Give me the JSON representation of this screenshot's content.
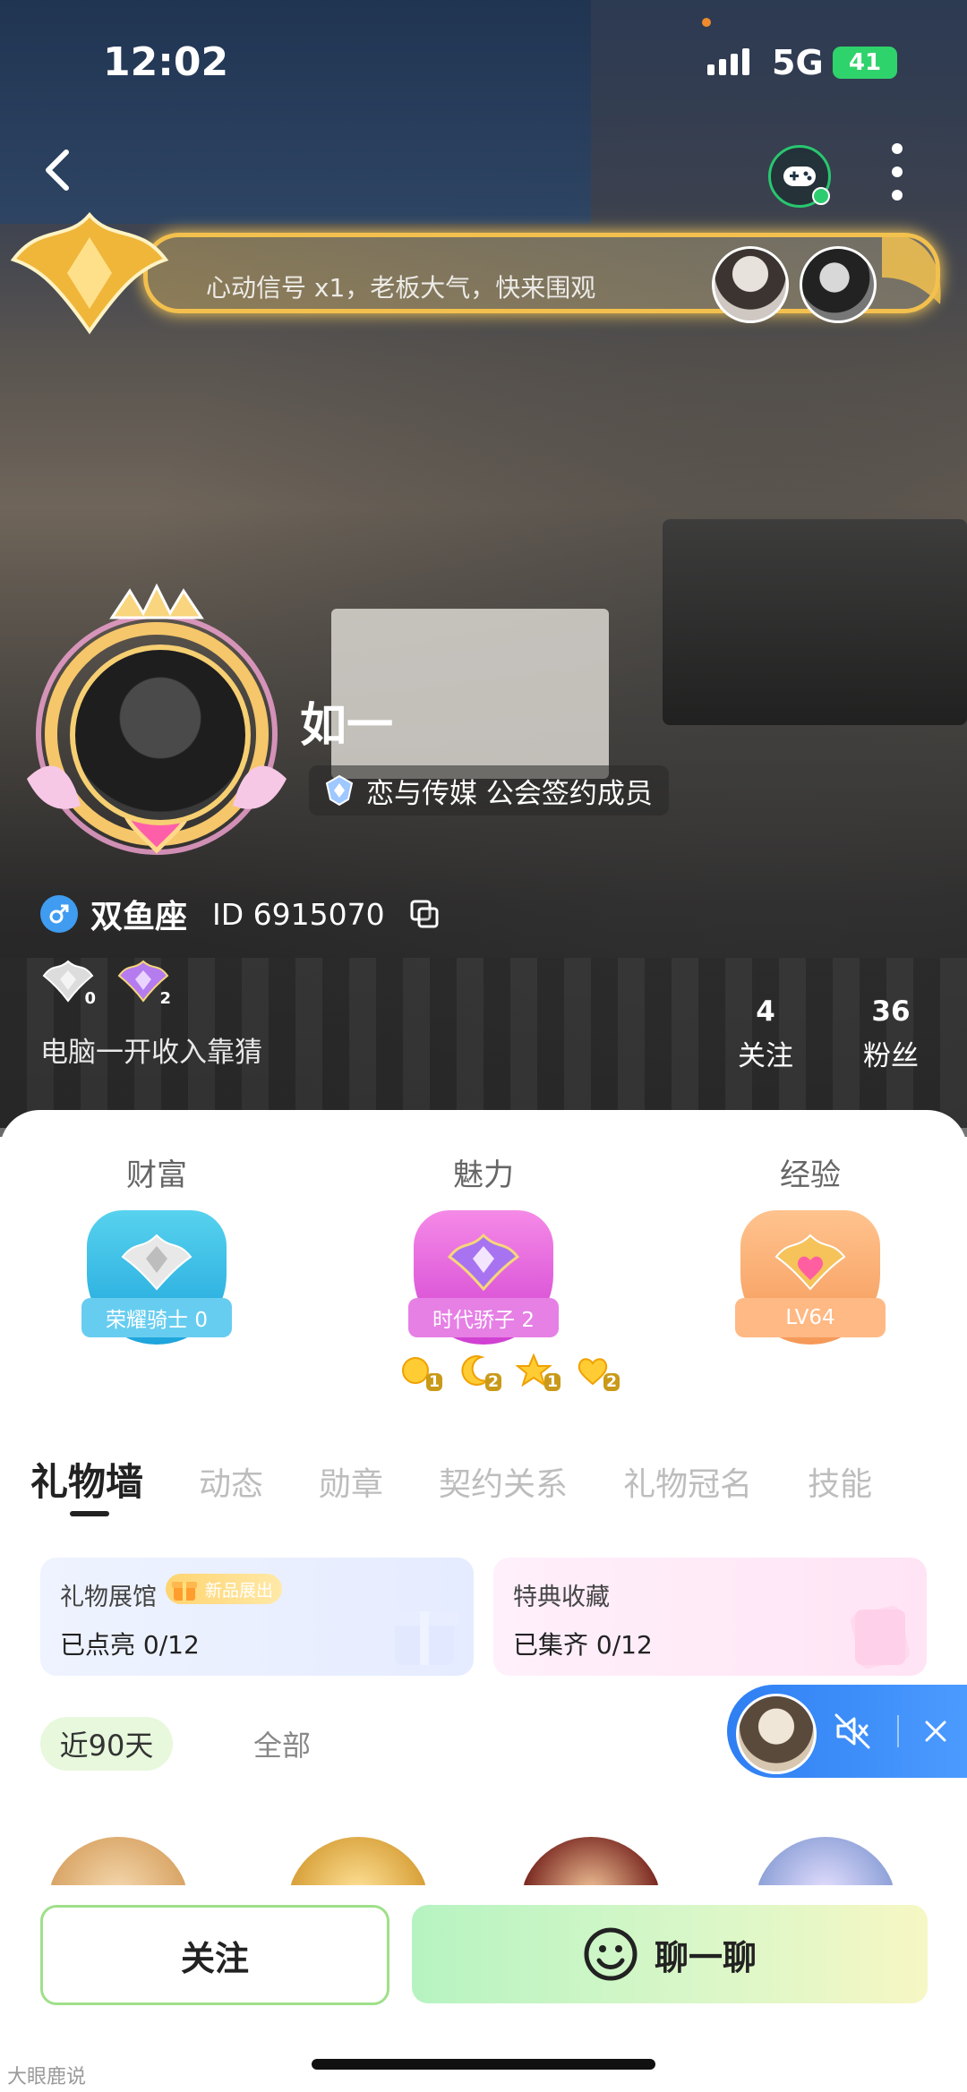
{
  "status_bar": {
    "time": "12:02",
    "network": "5G",
    "battery": "41"
  },
  "banner": {
    "text": "心动信号 x1，老板大气，快来围观"
  },
  "profile": {
    "nickname": "如一",
    "guild": "恋与传媒 公会签约成员",
    "zodiac": "双鱼座",
    "user_id": "ID 6915070",
    "signature": "电脑一开收入靠猜",
    "mini_badges": [
      "0",
      "2"
    ],
    "stats": [
      {
        "num": "4",
        "label": "关注"
      },
      {
        "num": "36",
        "label": "粉丝"
      }
    ]
  },
  "levels": [
    {
      "title": "财富",
      "ribbon": "荣耀骑士 0"
    },
    {
      "title": "魅力",
      "ribbon": "时代骄子 2"
    },
    {
      "title": "经验",
      "ribbon": "LV64"
    }
  ],
  "charm_subbadges": [
    "1",
    "2",
    "1",
    "2"
  ],
  "tabs": [
    "礼物墙",
    "动态",
    "勋章",
    "契约关系",
    "礼物冠名",
    "技能"
  ],
  "cards": {
    "gift": {
      "title": "礼物展馆",
      "tag": "新品展出",
      "value": "已点亮 0/12"
    },
    "collect": {
      "title": "特典收藏",
      "value": "已集齐 0/12"
    }
  },
  "filters": [
    "近90天",
    "全部"
  ],
  "buttons": {
    "follow": "关注",
    "chat": "聊一聊"
  },
  "watermark": "大眼鹿说",
  "colors": {
    "accent_green": "#9fe08a",
    "player_blue": "#2f7ff3",
    "gold": "#f3c04e"
  }
}
